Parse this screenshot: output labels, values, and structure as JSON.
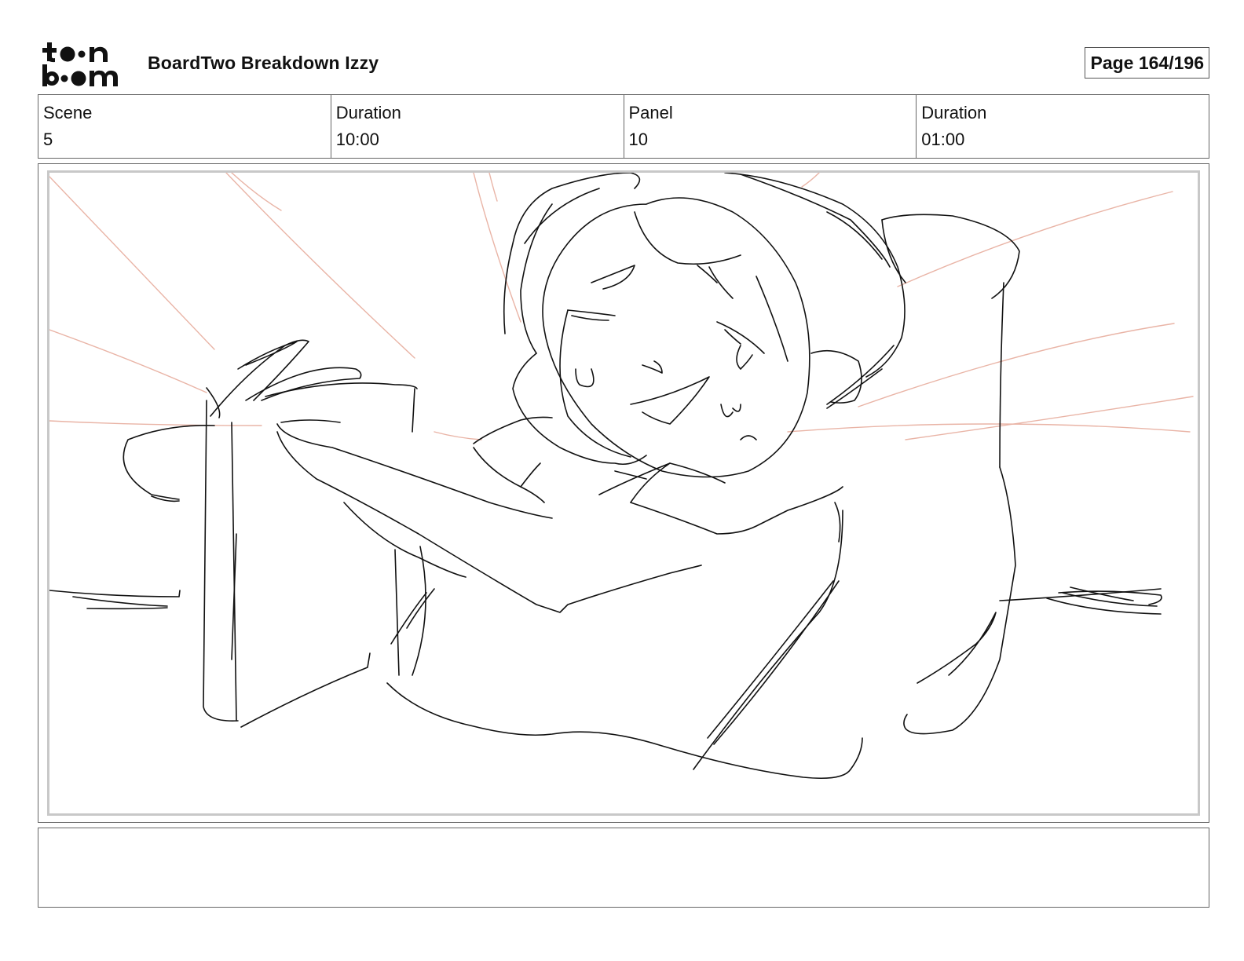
{
  "header": {
    "logo_text": "toon boom",
    "title": "BoardTwo Breakdown Izzy",
    "page_indicator": "Page 164/196"
  },
  "info": {
    "scene_label": "Scene",
    "scene_value": "5",
    "scene_duration_label": "Duration",
    "scene_duration_value": "10:00",
    "panel_label": "Panel",
    "panel_value": "10",
    "panel_duration_label": "Duration",
    "panel_duration_value": "01:00"
  },
  "panel": {
    "image_name": "storyboard-sketch",
    "line_color": "#111111",
    "accent_line_color": "#e9b4a6",
    "frame_color": "#c8c8c8"
  },
  "notes": {
    "text": ""
  }
}
